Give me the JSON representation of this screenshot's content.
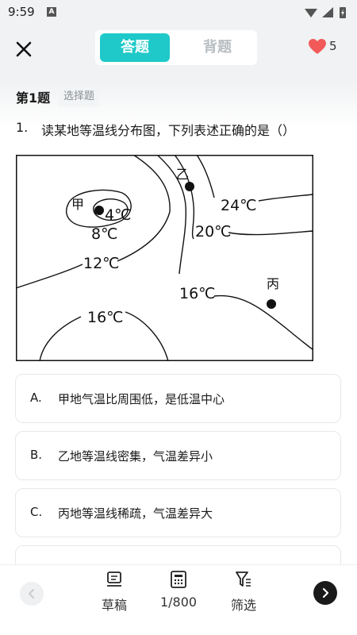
{
  "status_bar": {
    "time": "9:59",
    "notification_icon": "A"
  },
  "header": {
    "tabs": [
      {
        "label": "答题",
        "active": true
      },
      {
        "label": "背题",
        "active": false
      }
    ],
    "hearts": "5",
    "accent_color": "#1fc9c9",
    "heart_color": "#f25a5a"
  },
  "question": {
    "number_label": "第1题",
    "type_label": "选择题",
    "index": "1.",
    "text": "读某地等温线分布图，下列表述正确的是（）",
    "map_labels": {
      "jia": "甲",
      "yi": "乙",
      "bing": "丙",
      "t4": "4℃",
      "t8": "8℃",
      "t12": "12℃",
      "t16a": "16℃",
      "t16b": "16℃",
      "t20": "20℃",
      "t24": "24℃"
    }
  },
  "options": [
    {
      "letter": "A.",
      "text": "甲地气温比周围低，是低温中心"
    },
    {
      "letter": "B.",
      "text": "乙地等温线密集，气温差异小"
    },
    {
      "letter": "C.",
      "text": "丙地等温线稀疏，气温差异大"
    }
  ],
  "bottom_bar": {
    "draft_label": "草稿",
    "progress_label": "1/800",
    "filter_label": "筛选"
  }
}
